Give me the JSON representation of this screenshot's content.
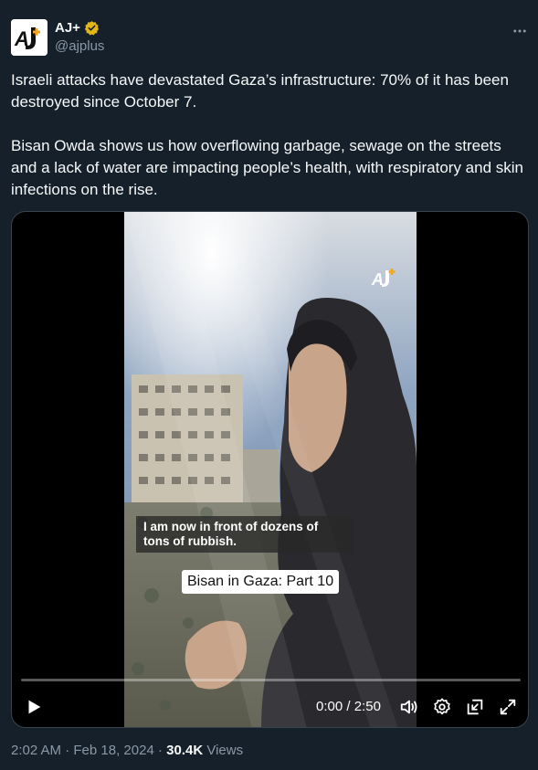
{
  "author": {
    "name": "AJ+",
    "handle": "@ajplus",
    "avatar_icon": "aj-plus-logo",
    "verified_icon": "verified-badge-icon",
    "verified_color": "#e2b719"
  },
  "tweet": {
    "paragraph1": "Israeli attacks have devastated Gaza’s infrastructure: 70% of it has been destroyed since October 7.",
    "paragraph2": "Bisan Owda shows us how overflowing garbage, sewage on the streets and a lack of water are impacting people’s health, with respiratory and skin infections on the rise."
  },
  "video": {
    "caption": "I am now in front of dozens of tons of rubbish.",
    "title_badge": "Bisan in Gaza: Part 10",
    "current_time": "0:00",
    "separator": "/",
    "duration": "2:50",
    "progress_fraction": 0,
    "watermark_icon": "aj-plus-watermark"
  },
  "meta": {
    "time": "2:02 AM",
    "dot1": "·",
    "date": "Feb 18, 2024",
    "dot2": "·",
    "views_count": "30.4K",
    "views_label": "Views"
  },
  "colors": {
    "background": "#15202b",
    "text": "#f7f9f9",
    "secondary": "#8b98a5",
    "border": "#38444d"
  }
}
